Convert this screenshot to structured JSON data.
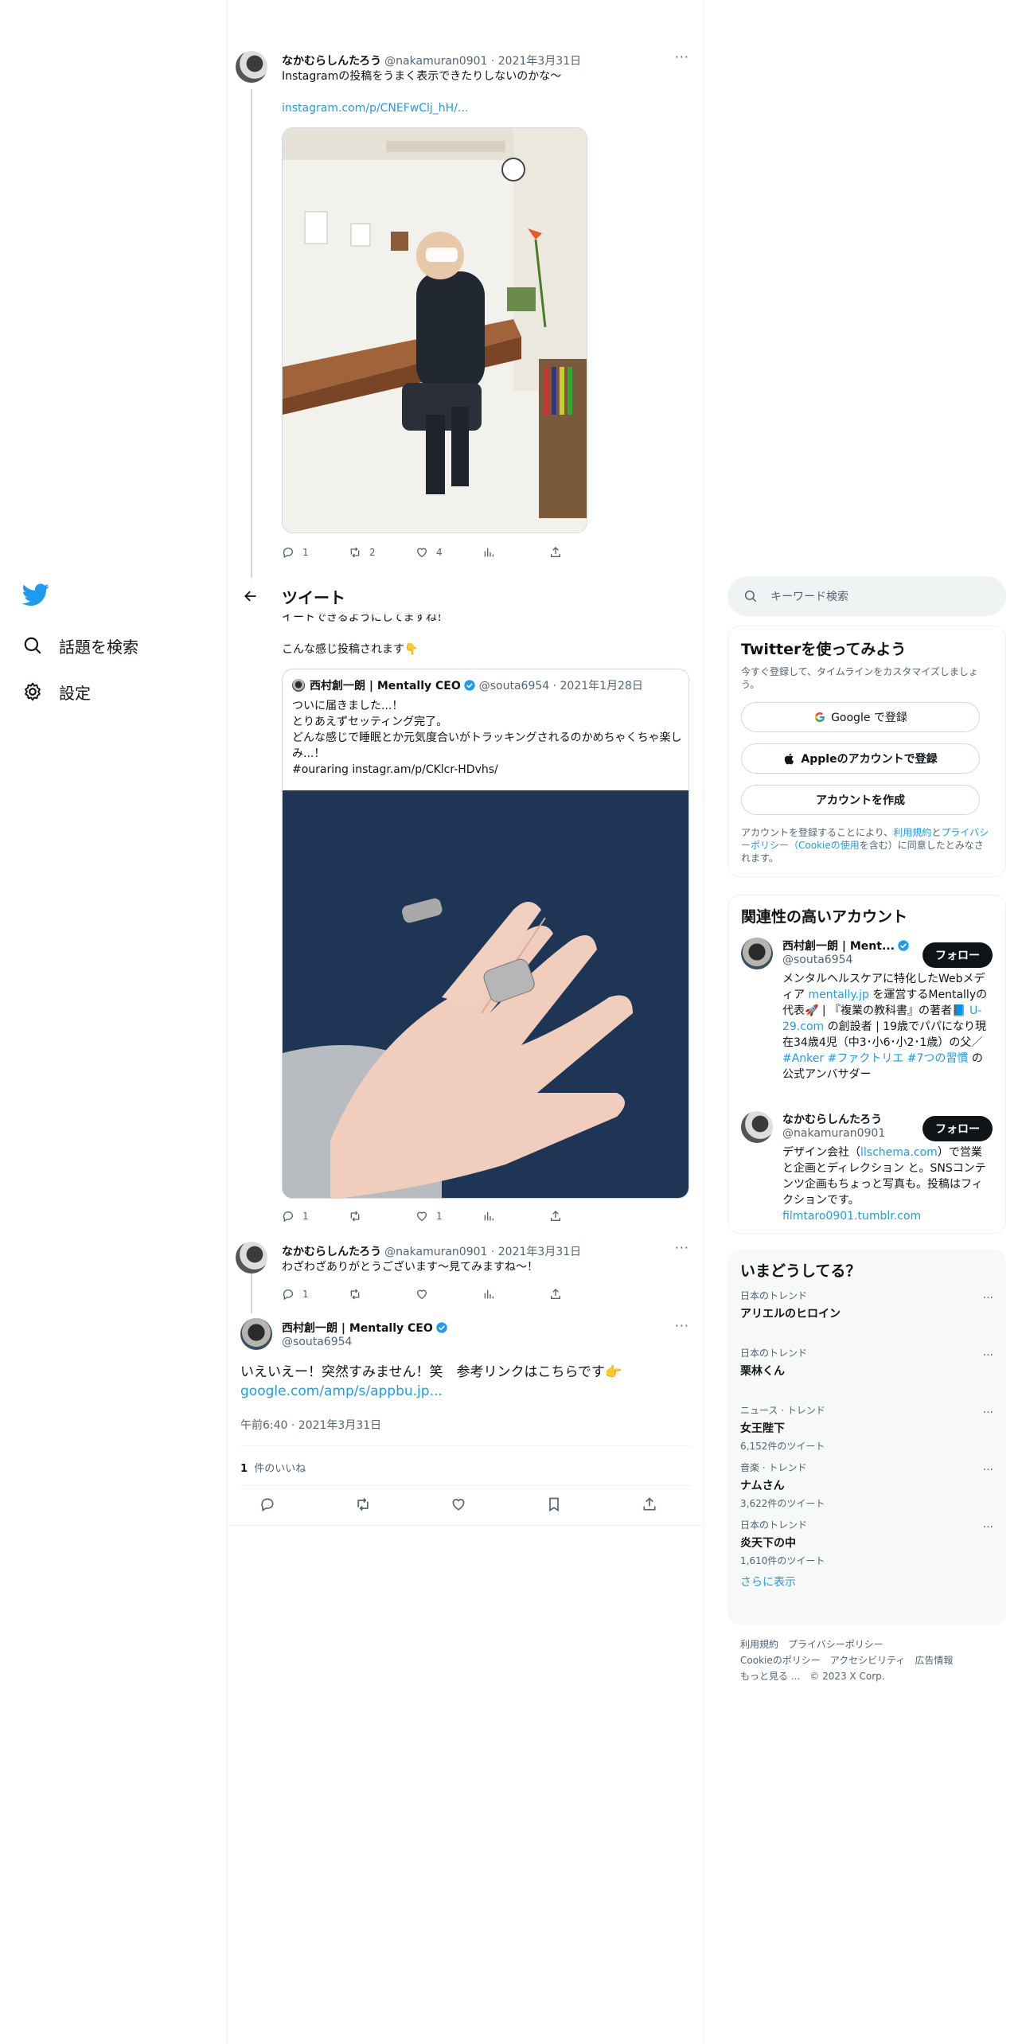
{
  "nav": {
    "items": [
      {
        "label": "話題を検索",
        "icon": "search-icon"
      },
      {
        "label": "設定",
        "icon": "gear-icon"
      }
    ]
  },
  "header": {
    "title": "ツイート"
  },
  "tweets": [
    {
      "name": "なかむらしんたろう",
      "handle": "@nakamuran0901 · 2021年3月31日",
      "text": "Instagramの投稿をうまく表示できたりしないのかな〜",
      "link": "instagram.com/p/CNEFwClj_hH/...",
      "replies": "1",
      "retweets": "2",
      "likes": "4"
    }
  ],
  "middle": {
    "cut_text": "イートできるようにしてますね！",
    "text": "こんな感じ投稿されます👇"
  },
  "quote": {
    "name": "西村創一朗 | Mentally CEO",
    "handle": "@souta6954 · 2021年1月28日",
    "lines": [
      "ついに届きました...！",
      "とりあえずセッティング完了。",
      "どんな感じで睡眠とか元気度合いがトラッキングされるのかめちゃくちゃ楽しみ...！",
      "#ouraring instagr.am/p/CKlcr-HDvhs/"
    ],
    "replies": "1",
    "retweets": "",
    "likes": "1"
  },
  "reply": {
    "name": "なかむらしんたろう",
    "handle": "@nakamuran0901 · 2021年3月31日",
    "text": "わざわざありがとうございます〜見てみますね〜！",
    "replies": "1"
  },
  "focused": {
    "name": "西村創一朗 | Mentally CEO",
    "handle": "@souta6954",
    "text": "いえいえー！突然すみません！笑　参考リンクはこちらです👉",
    "link": "google.com/amp/s/appbu.jp...",
    "date": "午前6:40 · 2021年3月31日",
    "likes_count": "1",
    "likes_label": "件のいいね"
  },
  "search": {
    "placeholder": "キーワード検索"
  },
  "signup": {
    "title": "Twitterを使ってみよう",
    "sub": "今すぐ登録して、タイムラインをカスタマイズしましょう。",
    "google": "Google で登録",
    "apple": "Appleのアカウントで登録",
    "create": "アカウントを作成",
    "legal_1": "アカウントを登録することにより、",
    "legal_terms": "利用規約",
    "legal_2": "と",
    "legal_privacy": "プライバシーポリシー（Cookieの使用",
    "legal_3": "を含む）に同意したとみなされます。"
  },
  "related": {
    "title": "関連性の高いアカウント",
    "accounts": [
      {
        "name": "西村創一朗 | Ment...",
        "handle": "@souta6954",
        "follow": "フォロー",
        "bio_1": "メンタルヘルスケアに特化したWebメディア ",
        "bio_link1": "mentally.jp",
        "bio_2": " を運営するMentallyの代表🚀 | 『複業の教科書』の著者📘 ",
        "bio_link2": "U-29.com",
        "bio_3": " の創設者 | 19歳でパパになり現在34歳4児（中3･小6･小2･1歳）の父／ ",
        "bio_link3": "#Anker #ファクトリエ #7つの習慣",
        "bio_4": " の公式アンバサダー"
      },
      {
        "name": "なかむらしんたろう",
        "handle": "@nakamuran0901",
        "follow": "フォロー",
        "bio_1": "デザイン会社（",
        "bio_link1": "llschema.com",
        "bio_2": "）で営業と企画とディレクション と。SNSコンテンツ企画もちょっと写真も。投稿はフィクションです。",
        "bio_link2": "filmtaro0901.tumblr.com"
      }
    ]
  },
  "trends": {
    "title": "いまどうしてる？",
    "items": [
      {
        "category": "日本のトレンド",
        "name": "アリエルのヒロイン",
        "count": ""
      },
      {
        "category": "日本のトレンド",
        "name": "栗林くん",
        "count": ""
      },
      {
        "category": "ニュース · トレンド",
        "name": "女王陛下",
        "count": "6,152件のツイート"
      },
      {
        "category": "音楽 · トレンド",
        "name": "ナムさん",
        "count": "3,622件のツイート"
      },
      {
        "category": "日本のトレンド",
        "name": "炎天下の中",
        "count": "1,610件のツイート"
      }
    ],
    "show_more": "さらに表示"
  },
  "footer": {
    "terms": "利用規約",
    "privacy": "プライバシーポリシー",
    "cookie": "Cookieのポリシー",
    "accessibility": "アクセシビリティ",
    "ads": "広告情報",
    "more": "もっと見る ...",
    "copyright": "© 2023 X Corp."
  },
  "colors": {
    "accent": "#1d9bf0",
    "text": "#0f1419",
    "muted": "#536471",
    "border": "#eff3f4"
  }
}
